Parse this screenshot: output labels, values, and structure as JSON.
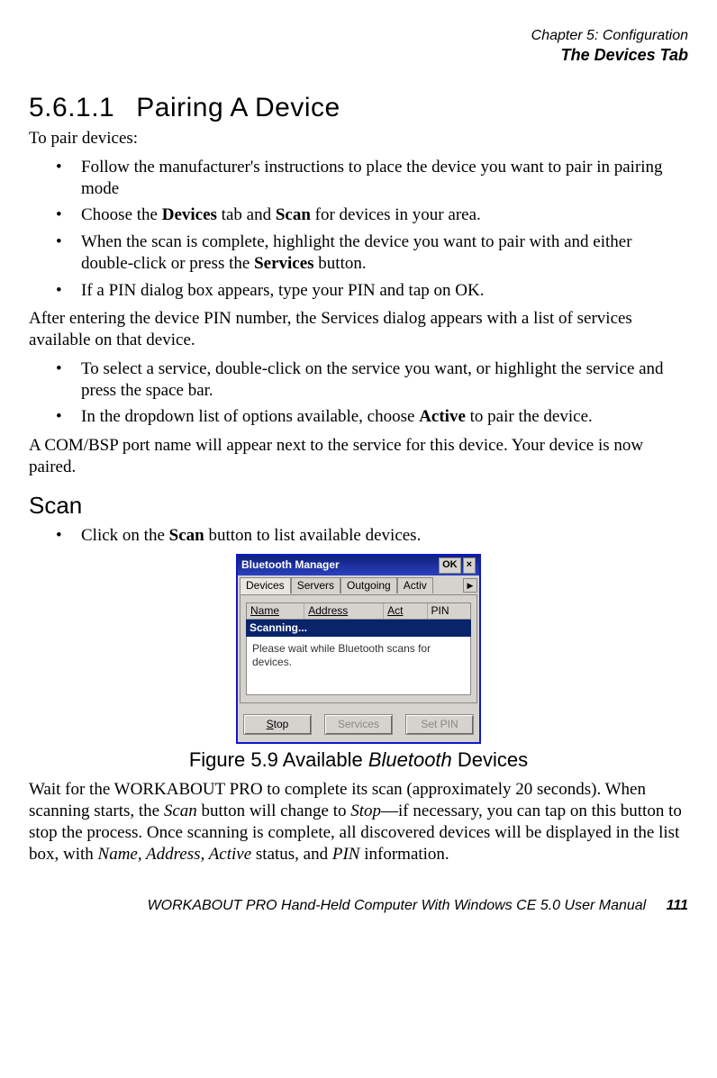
{
  "header": {
    "chapter": "Chapter 5: Configuration",
    "section": "The Devices Tab"
  },
  "h_number": "5.6.1.1",
  "h_title": "Pairing A Device",
  "intro": "To pair devices:",
  "list1": {
    "i1a": "Follow the manufacturer's instructions to place the device you want to pair in pairing mode",
    "i2a": "Choose the ",
    "i2b": "Devices",
    "i2c": " tab and ",
    "i2d": "Scan",
    "i2e": " for devices in your area.",
    "i3a": "When the scan is complete, highlight the device you want to pair with and either double-click or press the ",
    "i3b": "Services",
    "i3c": " button.",
    "i4a": "If a PIN dialog box appears, type your PIN and tap on OK."
  },
  "after_pin": "After entering the device PIN number, the Services dialog appears with a list of services available on that device.",
  "list2": {
    "i1": "To select a service, double-click on the service you want, or highlight the service and press the space bar.",
    "i2a": "In the dropdown list of options available, choose ",
    "i2b": "Active",
    "i2c": " to pair the device."
  },
  "com_para": "A COM/BSP port name will appear next to the service for this device. Your device is now paired.",
  "scan_heading": "Scan",
  "list3": {
    "i1a": "Click on the ",
    "i1b": "Scan",
    "i1c": " button to list available devices."
  },
  "btwin": {
    "title": "Bluetooth Manager",
    "ok": "OK",
    "close": "×",
    "tabs": {
      "devices": "Devices",
      "servers": "Servers",
      "outgoing": "Outgoing",
      "active": "Activ"
    },
    "cols": {
      "name": "Name",
      "address": "Address",
      "act": "Act",
      "pin": "PIN"
    },
    "scanning": "Scanning...",
    "msg": "Please wait while Bluetooth scans for devices.",
    "btns": {
      "stop_u": "S",
      "stop_rest": "top",
      "services": "Services",
      "setpin": "Set PIN"
    }
  },
  "figcap": {
    "a": "Figure 5.9 Available ",
    "b": "Bluetooth",
    "c": " Devices"
  },
  "wait_para": {
    "a": "Wait for the WORKABOUT PRO to complete its scan (approximately 20 seconds). When scanning starts, the ",
    "b": "Scan",
    "c": " button will change to ",
    "d": "Stop",
    "e": "—if necessary, you can tap on this button to stop the process. Once scanning is complete, all discovered devices will be displayed in the list box, with ",
    "f": "Name, Address, Active",
    "g": " status, and ",
    "h": "PIN",
    "i": " information."
  },
  "footer": {
    "text": "WORKABOUT PRO Hand-Held Computer With Windows CE 5.0 User Manual",
    "page": "111"
  }
}
